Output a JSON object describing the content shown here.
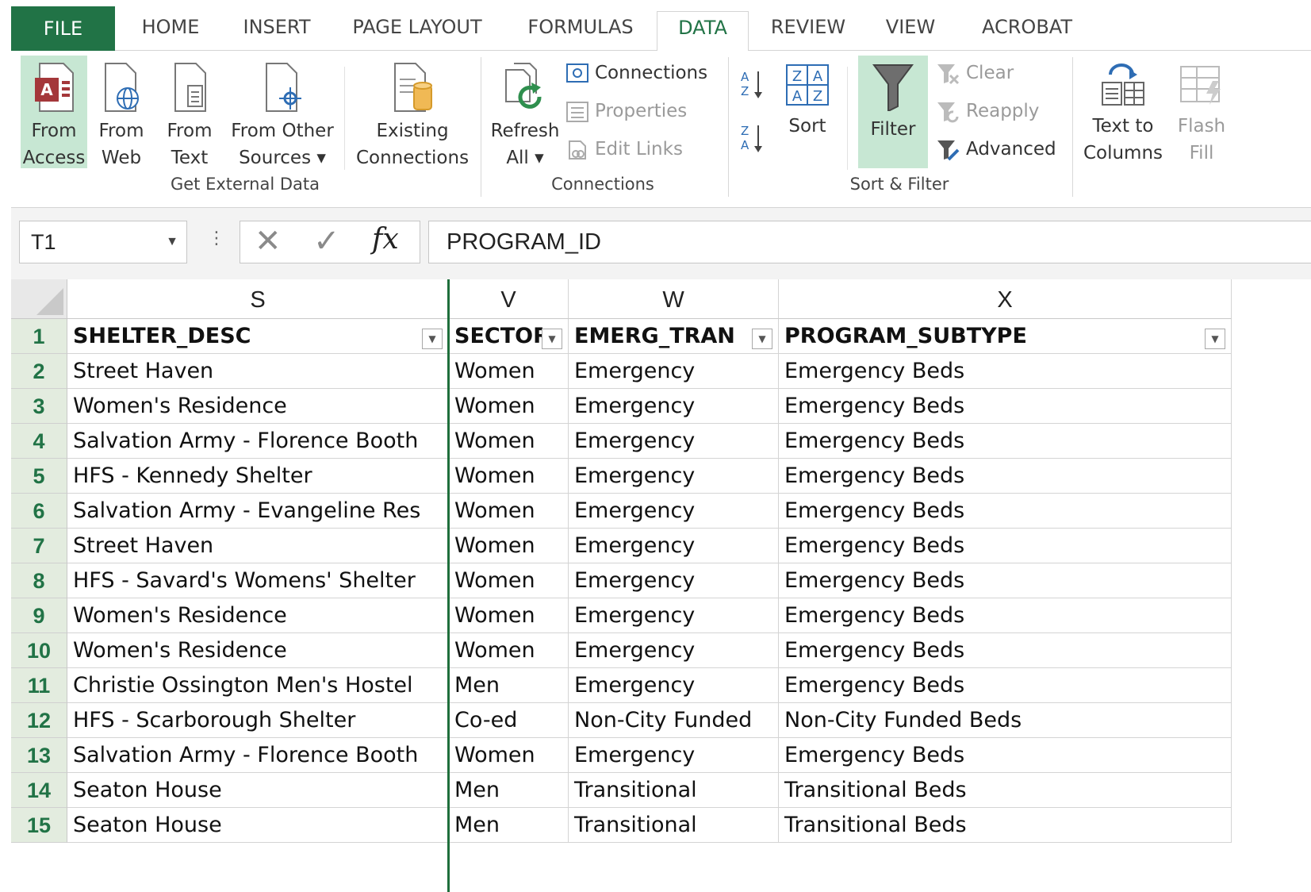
{
  "ribbon_tabs": [
    "FILE",
    "HOME",
    "INSERT",
    "PAGE LAYOUT",
    "FORMULAS",
    "DATA",
    "REVIEW",
    "VIEW",
    "ACROBAT"
  ],
  "active_tab": "DATA",
  "get_external": {
    "from_access": [
      "From",
      "Access"
    ],
    "from_web": [
      "From",
      "Web"
    ],
    "from_text": [
      "From",
      "Text"
    ],
    "from_other": [
      "From Other",
      "Sources ▾"
    ],
    "existing": [
      "Existing",
      "Connections"
    ],
    "label": "Get External Data"
  },
  "connections": {
    "refresh": [
      "Refresh",
      "All ▾"
    ],
    "connections": "Connections",
    "properties": "Properties",
    "edit_links": "Edit Links",
    "label": "Connections"
  },
  "sort_filter": {
    "sort": "Sort",
    "filter": "Filter",
    "clear": "Clear",
    "reapply": "Reapply",
    "advanced": "Advanced",
    "label": "Sort & Filter"
  },
  "data_tools": {
    "text_to_columns": [
      "Text to",
      "Columns"
    ],
    "flash_fill": [
      "Flash",
      "Fill"
    ]
  },
  "formula_bar": {
    "name_box": "T1",
    "fx": "fx",
    "value": "PROGRAM_ID"
  },
  "columns": [
    {
      "letter": "S",
      "header": "SHELTER_DESC"
    },
    {
      "letter": "V",
      "header": "SECTOR"
    },
    {
      "letter": "W",
      "header": "EMERG_TRAN"
    },
    {
      "letter": "X",
      "header": "PROGRAM_SUBTYPE"
    }
  ],
  "rows": [
    {
      "n": "1"
    },
    {
      "n": "2",
      "cells": [
        "Street Haven",
        "Women",
        "Emergency",
        "Emergency Beds"
      ]
    },
    {
      "n": "3",
      "cells": [
        "Women's Residence",
        "Women",
        "Emergency",
        "Emergency Beds"
      ]
    },
    {
      "n": "4",
      "cells": [
        "Salvation Army - Florence Booth",
        "Women",
        "Emergency",
        "Emergency Beds"
      ]
    },
    {
      "n": "5",
      "cells": [
        "HFS - Kennedy Shelter",
        "Women",
        "Emergency",
        "Emergency Beds"
      ]
    },
    {
      "n": "6",
      "cells": [
        "Salvation Army - Evangeline Res",
        "Women",
        "Emergency",
        "Emergency Beds"
      ]
    },
    {
      "n": "7",
      "cells": [
        "Street Haven",
        "Women",
        "Emergency",
        "Emergency Beds"
      ]
    },
    {
      "n": "8",
      "cells": [
        "HFS - Savard's Womens' Shelter",
        "Women",
        "Emergency",
        "Emergency Beds"
      ]
    },
    {
      "n": "9",
      "cells": [
        "Women's Residence",
        "Women",
        "Emergency",
        "Emergency Beds"
      ]
    },
    {
      "n": "10",
      "cells": [
        "Women's Residence",
        "Women",
        "Emergency",
        "Emergency Beds"
      ]
    },
    {
      "n": "11",
      "cells": [
        "Christie Ossington Men's Hostel",
        "Men",
        "Emergency",
        "Emergency Beds"
      ]
    },
    {
      "n": "12",
      "cells": [
        "HFS - Scarborough Shelter",
        "Co-ed",
        "Non-City Funded",
        "Non-City Funded Beds"
      ]
    },
    {
      "n": "13",
      "cells": [
        "Salvation Army - Florence Booth",
        "Women",
        "Emergency",
        "Emergency Beds"
      ]
    },
    {
      "n": "14",
      "cells": [
        "Seaton House",
        "Men",
        "Transitional",
        "Transitional Beds"
      ]
    },
    {
      "n": "15",
      "cells": [
        "Seaton House",
        "Men",
        "Transitional",
        "Transitional Beds"
      ]
    }
  ],
  "colors": {
    "accent": "#217346",
    "filter_highlight": "#c7e7d3"
  }
}
